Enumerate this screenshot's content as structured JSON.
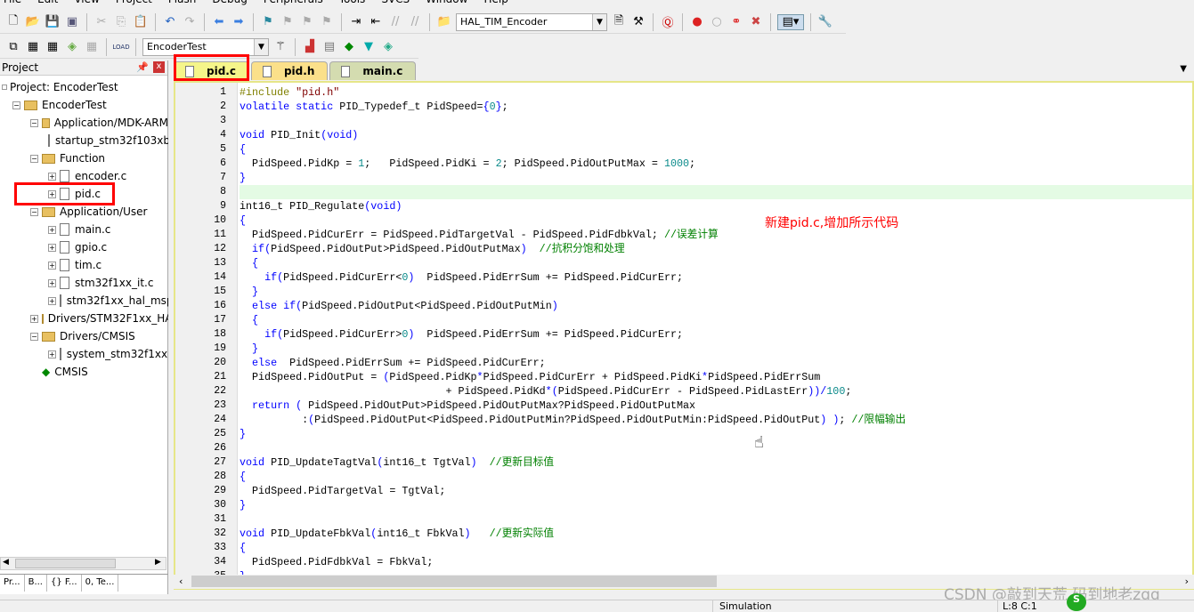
{
  "menu": [
    "File",
    "Edit",
    "View",
    "Project",
    "Flash",
    "Debug",
    "Peripherals",
    "Tools",
    "SVCS",
    "Window",
    "Help"
  ],
  "toolbar": {
    "target_combo": "HAL_TIM_Encoder",
    "project_combo": "EncoderTest",
    "load_label": "LOAD"
  },
  "project_panel": {
    "title": "Project",
    "pin": "ª",
    "close": "x",
    "items": [
      {
        "label": "Project: EncoderTest",
        "depth": 0,
        "type": "root"
      },
      {
        "label": "EncoderTest",
        "depth": 0,
        "type": "folder",
        "exp": "-"
      },
      {
        "label": "Application/MDK-ARM",
        "depth": 1,
        "type": "folder",
        "exp": "-"
      },
      {
        "label": "startup_stm32f103xb.s",
        "depth": 2,
        "type": "file"
      },
      {
        "label": "Function",
        "depth": 1,
        "type": "folder",
        "exp": "-"
      },
      {
        "label": "encoder.c",
        "depth": 2,
        "type": "file",
        "exp": "+"
      },
      {
        "label": "pid.c",
        "depth": 2,
        "type": "file",
        "exp": "+"
      },
      {
        "label": "Application/User",
        "depth": 1,
        "type": "folder",
        "exp": "-"
      },
      {
        "label": "main.c",
        "depth": 2,
        "type": "file",
        "exp": "+"
      },
      {
        "label": "gpio.c",
        "depth": 2,
        "type": "file",
        "exp": "+"
      },
      {
        "label": "tim.c",
        "depth": 2,
        "type": "file",
        "exp": "+"
      },
      {
        "label": "stm32f1xx_it.c",
        "depth": 2,
        "type": "file",
        "exp": "+"
      },
      {
        "label": "stm32f1xx_hal_msp.c",
        "depth": 2,
        "type": "file",
        "exp": "+"
      },
      {
        "label": "Drivers/STM32F1xx_HAL_Driver",
        "depth": 1,
        "type": "folder",
        "exp": "+"
      },
      {
        "label": "Drivers/CMSIS",
        "depth": 1,
        "type": "folder",
        "exp": "-"
      },
      {
        "label": "system_stm32f1xx.c",
        "depth": 2,
        "type": "file",
        "exp": "+"
      },
      {
        "label": "CMSIS",
        "depth": 1,
        "type": "component"
      }
    ],
    "bottom_tabs": [
      "Pr...",
      "B...",
      "{} F...",
      "0, Te..."
    ]
  },
  "tabs": [
    {
      "label": "pid.c",
      "bg": "#f5f58a"
    },
    {
      "label": "pid.h",
      "bg": "#fbe08a"
    },
    {
      "label": "main.c",
      "bg": "#d4dcb0"
    }
  ],
  "annotation": {
    "text": "新建pid.c,增加所示代码",
    "color": "#ff0000"
  },
  "code": {
    "current_line": 8,
    "lines": [
      "#include \"pid.h\"",
      "volatile static PID_Typedef_t PidSpeed={0};",
      "",
      "void PID_Init(void)",
      "{",
      "  PidSpeed.PidKp = 1;   PidSpeed.PidKi = 2; PidSpeed.PidOutPutMax = 1000;",
      "}",
      "",
      "int16_t PID_Regulate(void)",
      "{",
      "  PidSpeed.PidCurErr = PidSpeed.PidTargetVal - PidSpeed.PidFdbkVal; //误差计算",
      "  if(PidSpeed.PidOutPut>PidSpeed.PidOutPutMax)  //抗积分饱和处理",
      "  {",
      "    if(PidSpeed.PidCurErr<0)  PidSpeed.PidErrSum += PidSpeed.PidCurErr;",
      "  }",
      "  else if(PidSpeed.PidOutPut<PidSpeed.PidOutPutMin)",
      "  {",
      "    if(PidSpeed.PidCurErr>0)  PidSpeed.PidErrSum += PidSpeed.PidCurErr;",
      "  }",
      "  else  PidSpeed.PidErrSum += PidSpeed.PidCurErr;",
      "  PidSpeed.PidOutPut = (PidSpeed.PidKp*PidSpeed.PidCurErr + PidSpeed.PidKi*PidSpeed.PidErrSum",
      "                                 + PidSpeed.PidKd*(PidSpeed.PidCurErr - PidSpeed.PidLastErr))/100;",
      "  return ( PidSpeed.PidOutPut>PidSpeed.PidOutPutMax?PidSpeed.PidOutPutMax",
      "          :(PidSpeed.PidOutPut<PidSpeed.PidOutPutMin?PidSpeed.PidOutPutMin:PidSpeed.PidOutPut) ); //限幅输出",
      "}",
      "",
      "void PID_UpdateTagtVal(int16_t TgtVal)  //更新目标值",
      "{",
      "  PidSpeed.PidTargetVal = TgtVal;",
      "}",
      "",
      "void PID_UpdateFbkVal(int16_t FbkVal)   //更新实际值",
      "{",
      "  PidSpeed.PidFdbkVal = FbkVal;",
      "}"
    ]
  },
  "status": {
    "mode": "Simulation",
    "position": "L:8 C:1"
  },
  "watermark": "CSDN @敲到天荒 码到地老zgg"
}
